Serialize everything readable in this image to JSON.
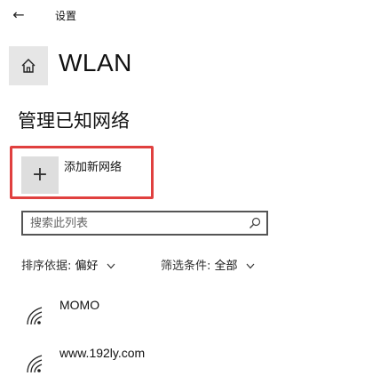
{
  "titlebar": {
    "back_glyph": "←",
    "title": "设置"
  },
  "header": {
    "home_icon": "home-icon",
    "title": "WLAN"
  },
  "section": {
    "title": "管理已知网络"
  },
  "add_network": {
    "plus_glyph": "+",
    "label": "添加新网络",
    "highlight_color": "#e0403f"
  },
  "search": {
    "placeholder": "搜索此列表",
    "icon": "search-icon"
  },
  "filters": {
    "sort": {
      "label": "排序依据:",
      "value": "偏好"
    },
    "status": {
      "label": "筛选条件:",
      "value": "全部"
    }
  },
  "networks": [
    {
      "name": "MOMO",
      "icon": "wifi-icon"
    },
    {
      "name": "www.192ly.com",
      "icon": "wifi-icon"
    }
  ]
}
